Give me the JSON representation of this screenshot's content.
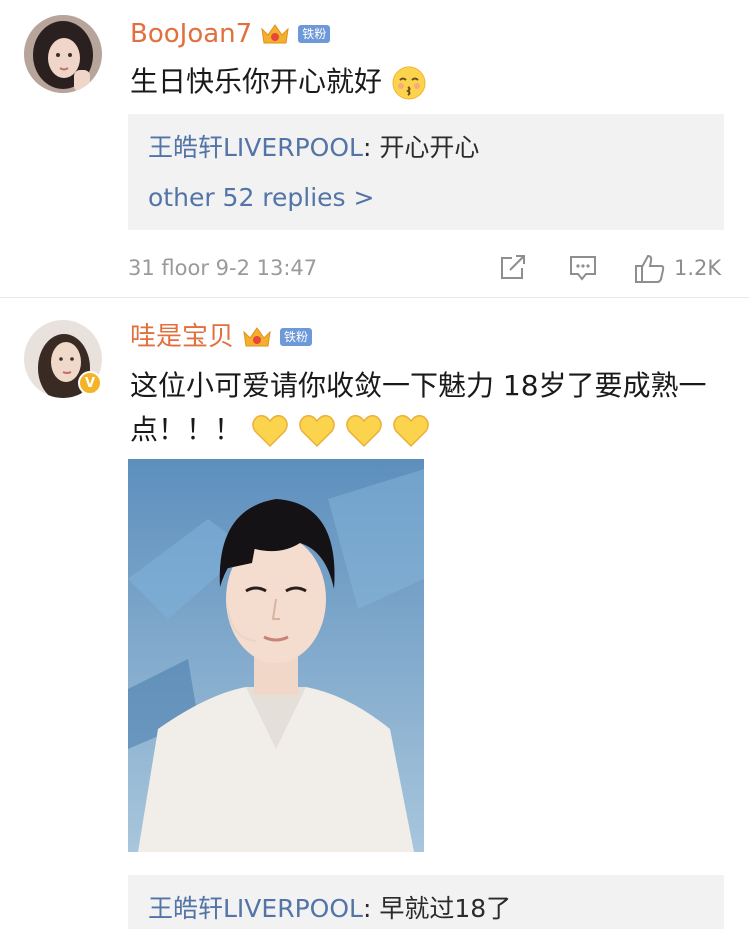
{
  "comments": [
    {
      "username": "BooJoan7",
      "fan_badge": "铁粉",
      "text": "生日快乐你开心就好",
      "reply": {
        "author": "王皓轩LIVERPOOL",
        "sep": ": ",
        "text": "开心开心"
      },
      "more_replies": "other 52 replies >",
      "meta": "31 floor 9-2 13:47",
      "likes": "1.2K",
      "icons": [
        "crown-icon",
        "kissing-face-emoji",
        "share-icon",
        "comment-icon",
        "like-icon"
      ]
    },
    {
      "username": "哇是宝贝",
      "fan_badge": "铁粉",
      "verified_mark": "V",
      "text": "这位小可爱请你收敛一下魅力 18岁了要成熟一点！！！",
      "reply": {
        "author": "王皓轩LIVERPOOL",
        "sep": ": ",
        "text": "早就过18了"
      },
      "icons": [
        "crown-icon",
        "yellow-heart-emoji",
        "verified-icon"
      ]
    }
  ],
  "colors": {
    "username": "#e2703f",
    "reply_author": "#5374a7",
    "fan_badge": "#6d98d9",
    "meta_text": "#9a9a9a",
    "reply_bg": "#f2f2f2",
    "verified": "#f5b427"
  }
}
